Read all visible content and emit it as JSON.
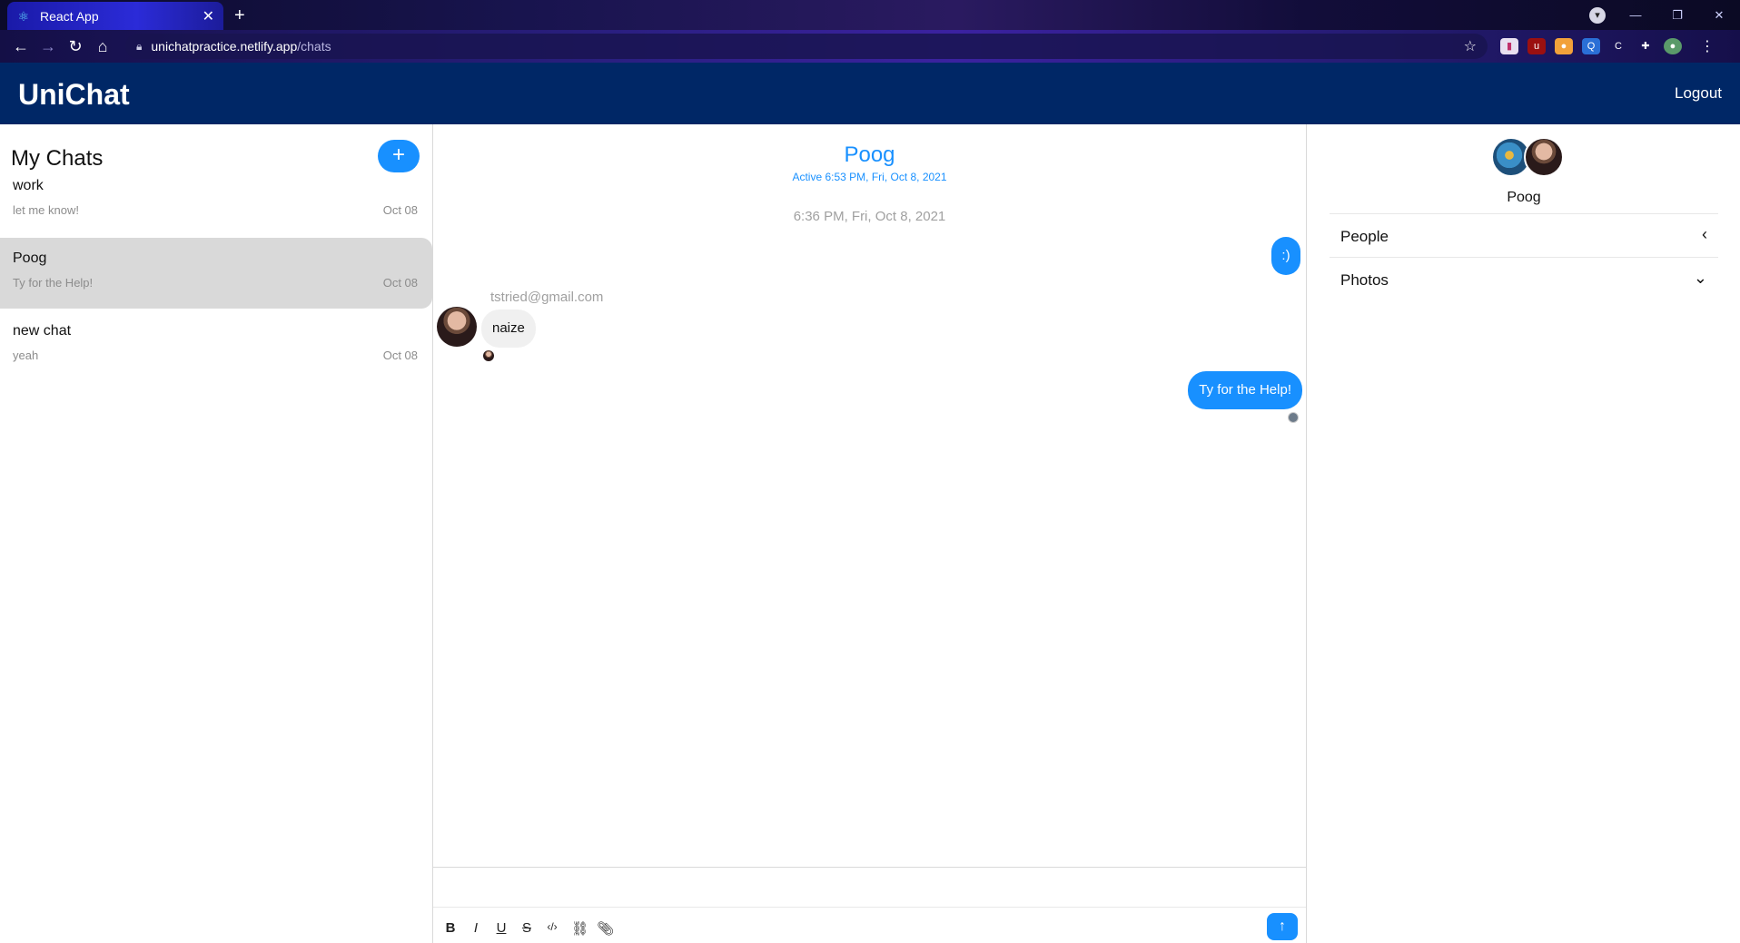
{
  "browser": {
    "tab_title": "React App",
    "url_host": "unichatpractice.netlify.app",
    "url_path": "/chats"
  },
  "app": {
    "title": "UniChat",
    "logout_label": "Logout"
  },
  "chat_list": {
    "title": "My Chats",
    "add_label": "+",
    "chats": [
      {
        "name": "work",
        "preview": "let me know!",
        "date": "Oct 08"
      },
      {
        "name": "Poog",
        "preview": "Ty for the Help!",
        "date": "Oct 08"
      },
      {
        "name": "new chat",
        "preview": "yeah",
        "date": "Oct 08"
      }
    ]
  },
  "feed": {
    "title": "Poog",
    "subtitle": "Active 6:53 PM, Fri, Oct 8, 2021",
    "timestamp": "6:36 PM, Fri, Oct 8, 2021",
    "messages": [
      {
        "text": ":)",
        "mine": true
      },
      {
        "sender": "tstried@gmail.com",
        "text": "naize",
        "mine": false
      },
      {
        "text": "Ty for the Help!",
        "mine": true
      }
    ]
  },
  "settings": {
    "chat_name": "Poog",
    "sections": [
      {
        "label": "People"
      },
      {
        "label": "Photos"
      }
    ]
  },
  "colors": {
    "header": "#002766",
    "accent": "#1890ff",
    "active_chat": "#d9d9d9"
  }
}
